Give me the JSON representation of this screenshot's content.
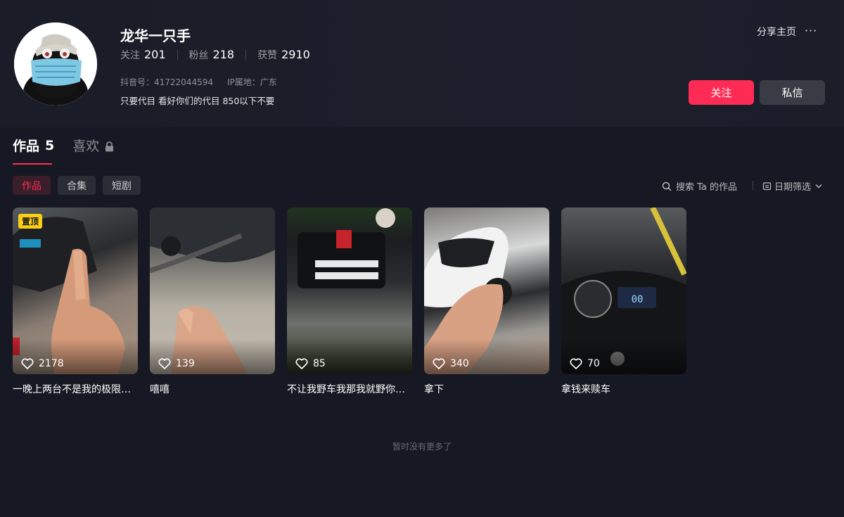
{
  "profile": {
    "name": "龙华一只手",
    "stats": [
      {
        "label": "关注",
        "value": "201"
      },
      {
        "label": "粉丝",
        "value": "218"
      },
      {
        "label": "获赞",
        "value": "2910"
      }
    ],
    "douyin_id": "抖音号：41722044594",
    "ip_location": "IP属地：广东",
    "bio": "只要代目 看好你们的代目 850以下不要"
  },
  "header_actions": {
    "share_label": "分享主页",
    "more_icon": "···",
    "follow_label": "关注",
    "message_label": "私信"
  },
  "colors": {
    "accent": "#fe2c55",
    "background": "#161823",
    "pin_badge": "#face15"
  },
  "tabs": [
    {
      "label": "作品",
      "count": "5",
      "active": true
    },
    {
      "label": "喜欢",
      "icon": "lock-icon",
      "active": false
    }
  ],
  "chips": [
    {
      "label": "作品",
      "active": true
    },
    {
      "label": "合集",
      "active": false
    },
    {
      "label": "短剧",
      "active": false
    }
  ],
  "toolbar": {
    "search_label": "搜索 Ta 的作品",
    "date_filter_label": "日期筛选"
  },
  "videos": [
    {
      "title": "一晚上两台不是我的极限…",
      "likes": "2178",
      "pinned": true,
      "pin_label": "置顶"
    },
    {
      "title": "嘻嘻",
      "likes": "139"
    },
    {
      "title": "不让我野车我那我就野你…",
      "likes": "85"
    },
    {
      "title": "拿下",
      "likes": "340"
    },
    {
      "title": "拿钱来赎车",
      "likes": "70"
    }
  ],
  "footer": {
    "end_text": "暂时没有更多了"
  }
}
